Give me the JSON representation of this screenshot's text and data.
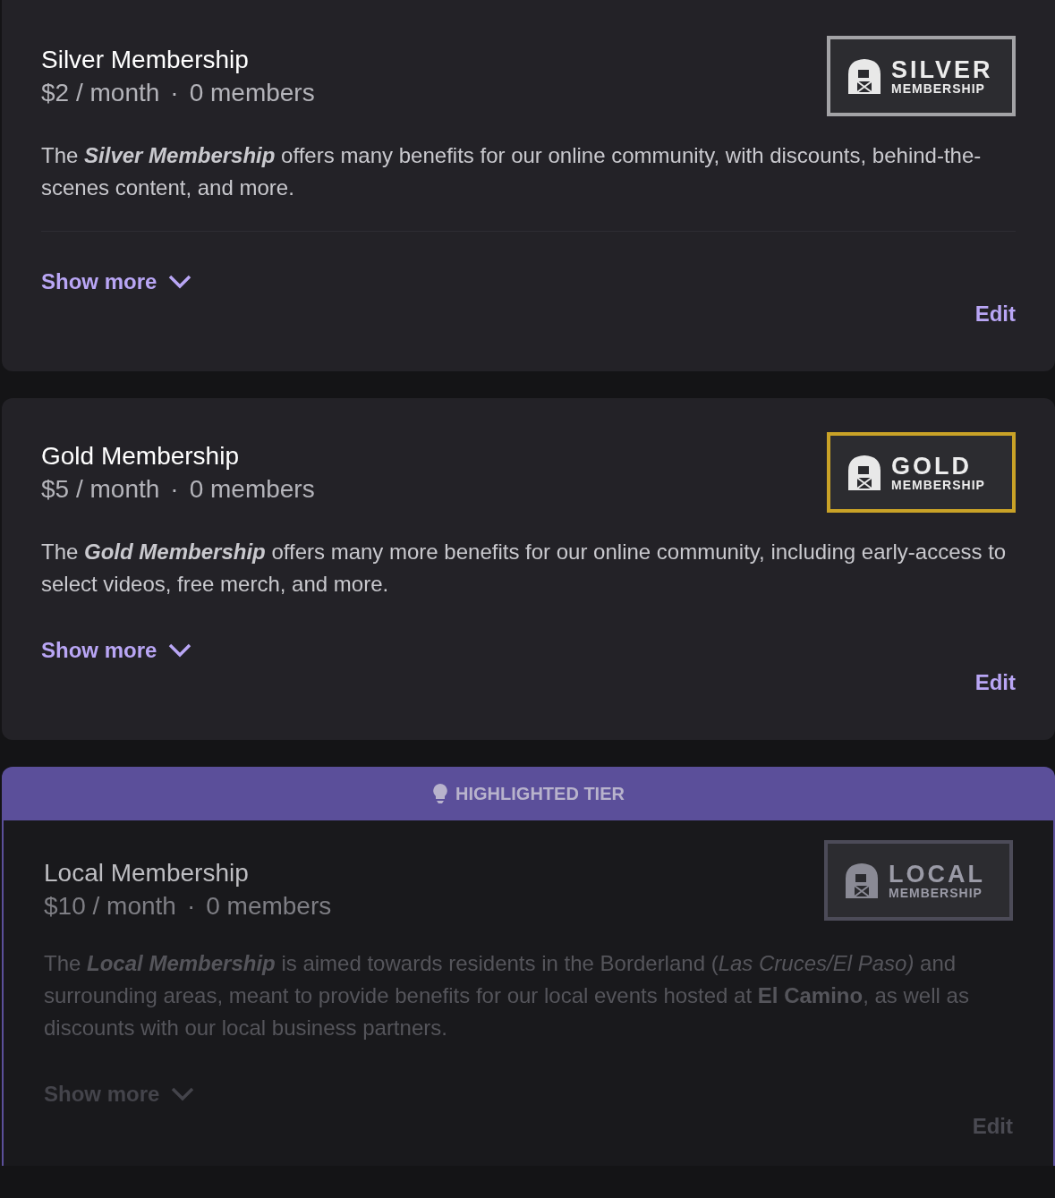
{
  "tiers": [
    {
      "title": "Silver Membership",
      "price": "$2 / month",
      "separator": "·",
      "members": "0 members",
      "highlighted": false,
      "faded": false,
      "divider": true,
      "badge": {
        "line1": "SILVER",
        "line2": "MEMBERSHIP",
        "color": "#a3a3a6"
      },
      "description": [
        {
          "kind": "plain",
          "text": "The "
        },
        {
          "kind": "bold_italic",
          "text": "Silver Membership"
        },
        {
          "kind": "plain",
          "text": " offers many benefits for our online community, with discounts, behind-the-scenes content, and more."
        }
      ],
      "show_more": "Show more",
      "edit": "Edit"
    },
    {
      "title": "Gold Membership",
      "price": "$5 / month",
      "separator": "·",
      "members": "0 members",
      "highlighted": false,
      "faded": false,
      "divider": false,
      "badge": {
        "line1": "GOLD",
        "line2": "MEMBERSHIP",
        "color": "#c9a227"
      },
      "description": [
        {
          "kind": "plain",
          "text": "The "
        },
        {
          "kind": "bold_italic",
          "text": "Gold Membership"
        },
        {
          "kind": "plain",
          "text": " offers many more benefits for our online community, including early-access to select videos, free merch, and more."
        }
      ],
      "show_more": "Show more",
      "edit": "Edit"
    },
    {
      "title": "Local Membership",
      "price": "$10 / month",
      "separator": "·",
      "members": "0 members",
      "highlighted": true,
      "banner": "HIGHLIGHTED TIER",
      "faded": true,
      "divider": false,
      "badge": {
        "line1": "LOCAL",
        "line2": "MEMBERSHIP",
        "color": "#4c4b58"
      },
      "description": [
        {
          "kind": "plain",
          "text": "The "
        },
        {
          "kind": "bold_italic",
          "text": "Local Membership"
        },
        {
          "kind": "plain",
          "text": " is aimed towards residents in the Borderland ("
        },
        {
          "kind": "italic",
          "text": "Las Cruces/El Paso)"
        },
        {
          "kind": "plain",
          "text": " and surrounding areas, meant to provide benefits for our local events hosted at "
        },
        {
          "kind": "bold",
          "text": "El Camino"
        },
        {
          "kind": "plain",
          "text": ", as well as discounts with our local business partners."
        }
      ],
      "show_more": "Show more",
      "edit": "Edit"
    }
  ]
}
